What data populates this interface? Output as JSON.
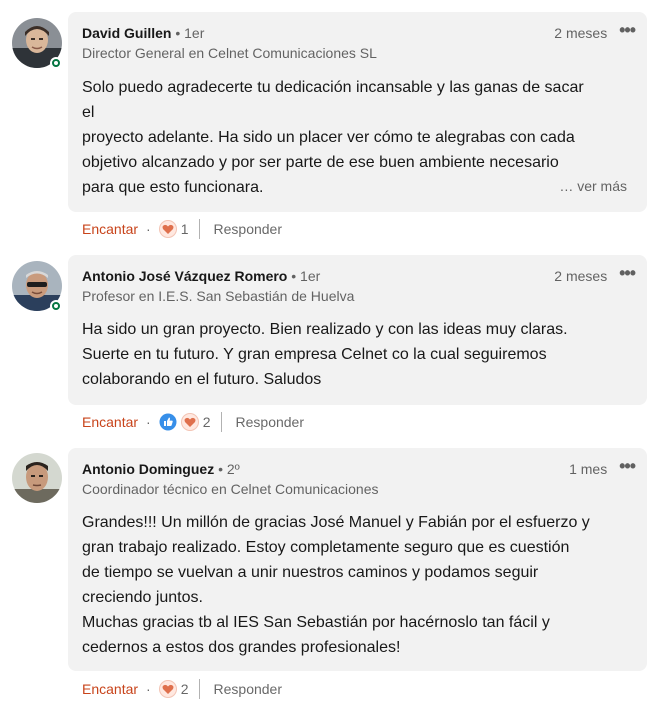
{
  "comments": [
    {
      "author": "David Guillen",
      "degree": "• 1er",
      "headline": "Director General en Celnet Comunicaciones SL",
      "time": "2 meses",
      "online": true,
      "lines": [
        "Solo puedo agradecerte tu dedicación incansable y las ganas de sacar",
        "el",
        "proyecto adelante. Ha sido un placer ver cómo te alegrabas con cada",
        "objetivo alcanzado y por ser parte de ese buen ambiente necesario",
        "para que esto funcionara."
      ],
      "see_more": "… ver más",
      "react_label": "Encantar",
      "reaction_icons": [
        "love-icon"
      ],
      "reaction_count": "1",
      "reply_label": "Responder"
    },
    {
      "author": "Antonio José Vázquez Romero",
      "degree": "• 1er",
      "headline": "Profesor en I.E.S. San Sebastián de Huelva",
      "time": "2 meses",
      "online": true,
      "lines": [
        "Ha sido un gran proyecto. Bien realizado y con las ideas muy claras.",
        "Suerte en tu futuro. Y gran empresa Celnet co la cual seguiremos",
        "colaborando en el futuro. Saludos"
      ],
      "react_label": "Encantar",
      "reaction_icons": [
        "like-icon",
        "love-icon"
      ],
      "reaction_count": "2",
      "reply_label": "Responder"
    },
    {
      "author": "Antonio Dominguez",
      "degree": "• 2º",
      "headline": "Coordinador técnico en Celnet Comunicaciones",
      "time": "1 mes",
      "online": false,
      "lines": [
        "Grandes!!! Un millón de gracias José Manuel y Fabián por el esfuerzo y",
        "gran trabajo realizado. Estoy completamente seguro que es cuestión",
        "de tiempo se vuelvan a unir nuestros caminos y podamos seguir",
        "creciendo juntos.",
        "Muchas gracias tb al IES San Sebastián por hacérnoslo tan fácil y",
        "cedernos a estos dos grandes profesionales!"
      ],
      "react_label": "Encantar",
      "reaction_icons": [
        "love-icon"
      ],
      "reaction_count": "2",
      "reply_label": "Responder"
    }
  ],
  "action_separator": "·",
  "more_menu_icon": "ellipsis-icon",
  "colors": {
    "bubble": "#f2f2f2",
    "react_accent": "#c8441b",
    "online": "#057642",
    "like_blue": "#378fe9",
    "love_red": "#df704d"
  }
}
